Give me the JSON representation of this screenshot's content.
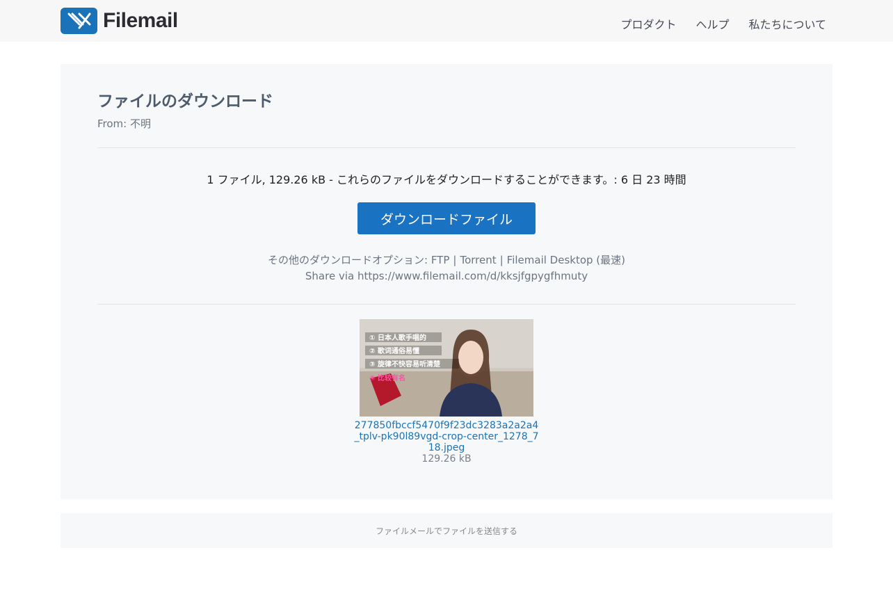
{
  "header": {
    "logo_text": "Filemail",
    "brand_color": "#1a73b8",
    "nav": [
      "プロダクト",
      "ヘルプ",
      "私たちについて"
    ]
  },
  "main": {
    "title": "ファイルのダウンロード",
    "from": "From: 不明",
    "summary": "1 ファイル, 129.26 kB - これらのファイルをダウンロードすることができます。: 6 日 23 時間",
    "download_button": "ダウンロードファイル",
    "options_prefix": "その他のダウンロードオプション: ",
    "options": [
      "FTP",
      "Torrent",
      "Filemail Desktop (最速)"
    ],
    "share": "Share via https://www.filemail.com/d/kksjfgpygfhmuty",
    "file": {
      "name": "277850fbccf5470f9f23dc3283a2a2a4_tplv-pk90l89vgd-crop-center_1278_718.jpeg",
      "size": "129.26 kB",
      "thumbnail_text": [
        "① 日本人歌手唱的",
        "② 歌词通俗易懂",
        "③ 旋律不快容易听清楚",
        "④ 比较有名"
      ]
    }
  },
  "footer": {
    "link": "ファイルメールでファイルを送信する"
  }
}
